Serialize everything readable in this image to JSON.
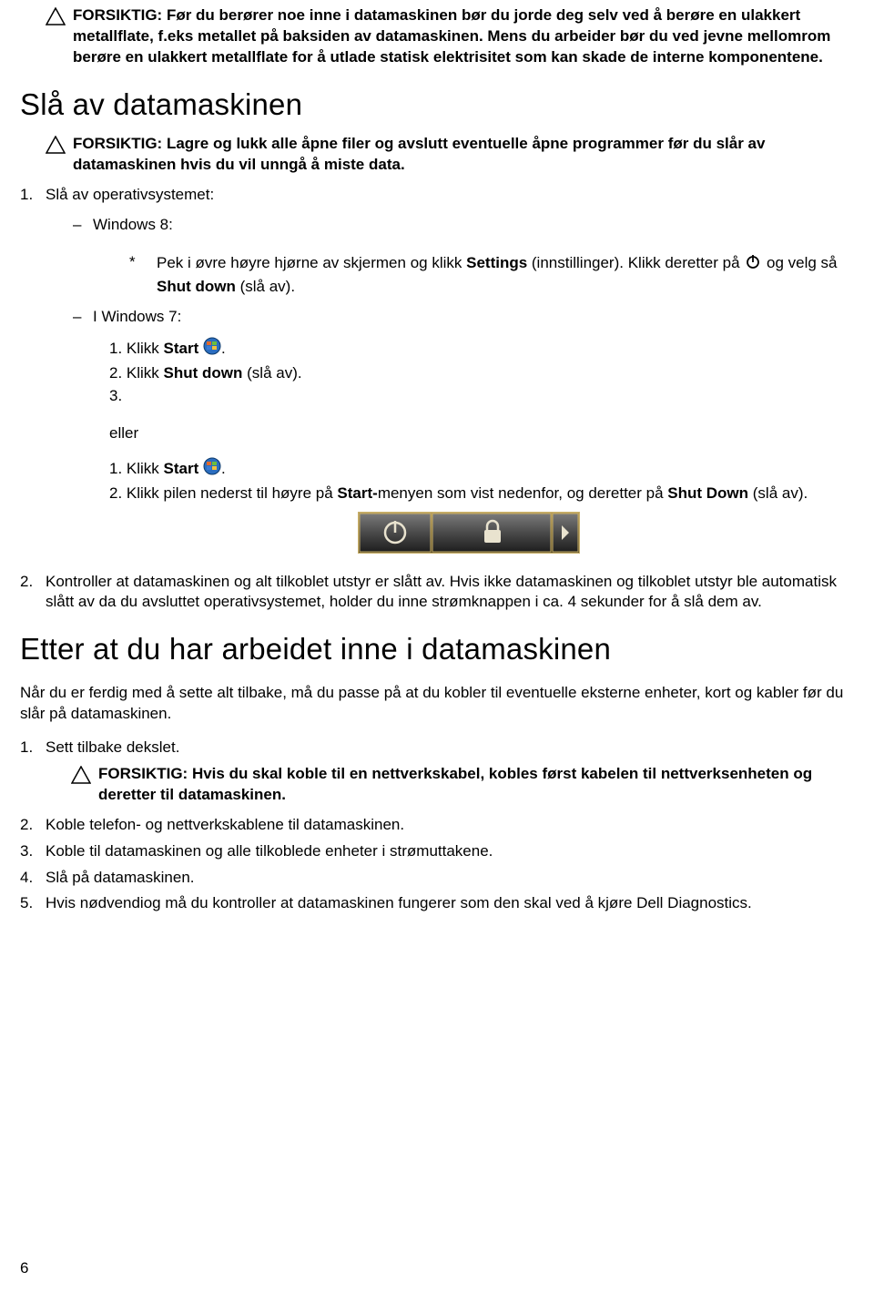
{
  "caution1": "FORSIKTIG: Før du berører noe inne i datamaskinen bør du jorde deg selv ved å berøre en ulakkert metallflate, f.eks metallet på baksiden av datamaskinen. Mens du arbeider bør du ved jevne mellomrom berøre en ulakkert metallflate for å utlade statisk elektrisitet som kan skade de interne komponentene.",
  "heading1": "Slå av datamaskinen",
  "caution2": "FORSIKTIG: Lagre og lukk alle åpne filer og avslutt eventuelle åpne programmer før du slår av datamaskinen hvis du vil unngå å miste data.",
  "step1_num": "1.",
  "step1_text": "Slå av operativsystemet:",
  "sub_win8_dash": "–",
  "sub_win8": "Windows 8:",
  "star": "*",
  "win8_pre": "Pek i øvre høyre hjørne av skjermen og klikk ",
  "win8_settings": "Settings",
  "win8_mid1": " (innstillinger). Klikk deretter på ",
  "win8_mid2": " og velg så ",
  "win8_shut": "Shut down",
  "win8_post": " (slå av).",
  "sub_win7_dash": "–",
  "sub_win7": "I Windows 7:",
  "w7a_1_n": "1. ",
  "w7a_1_pre": "Klikk ",
  "w7a_1_start": "Start ",
  "w7a_1_post": ".",
  "w7a_2_n": "2. ",
  "w7a_2_pre": "Klikk ",
  "w7a_2_shut": "Shut down",
  "w7a_2_post": " (slå av).",
  "w7a_3_n": "3.",
  "eller": "eller",
  "w7b_1_n": "1. ",
  "w7b_1_pre": "Klikk ",
  "w7b_1_start": "Start ",
  "w7b_1_post": ".",
  "w7b_2_n": "2. ",
  "w7b_2_pre": "Klikk pilen nederst til høyre på ",
  "w7b_2_startm": "Start-",
  "w7b_2_mid": "menyen som vist nedenfor, og deretter på ",
  "w7b_2_shut": "Shut Down",
  "w7b_2_post": " (slå av).",
  "step2_num": "2.",
  "step2_text": "Kontroller at datamaskinen og alt tilkoblet utstyr er slått av. Hvis ikke datamaskinen og tilkoblet utstyr ble automatisk slått av da du avsluttet operativsystemet, holder du inne strømknappen i ca. 4 sekunder for å slå dem av.",
  "heading2": "Etter at du har arbeidet inne i datamaskinen",
  "intro2": "Når du er ferdig med å sette alt tilbake, må du passe på at du kobler til eventuelle eksterne enheter, kort og kabler før du slår på datamaskinen.",
  "h2s1_num": "1.",
  "h2s1_text": "Sett tilbake dekslet.",
  "caution3": "FORSIKTIG: Hvis du skal koble til en nettverkskabel, kobles først kabelen til nettverksenheten og deretter til datamaskinen.",
  "h2s2_num": "2.",
  "h2s2_text": "Koble telefon- og nettverkskablene til datamaskinen.",
  "h2s3_num": "3.",
  "h2s3_text": "Koble til datamaskinen og alle tilkoblede enheter i strømuttakene.",
  "h2s4_num": "4.",
  "h2s4_text": "Slå på datamaskinen.",
  "h2s5_num": "5.",
  "h2s5_text": "Hvis nødvendiog må du kontroller at datamaskinen fungerer som den skal ved å kjøre Dell Diagnostics.",
  "page_number": "6"
}
